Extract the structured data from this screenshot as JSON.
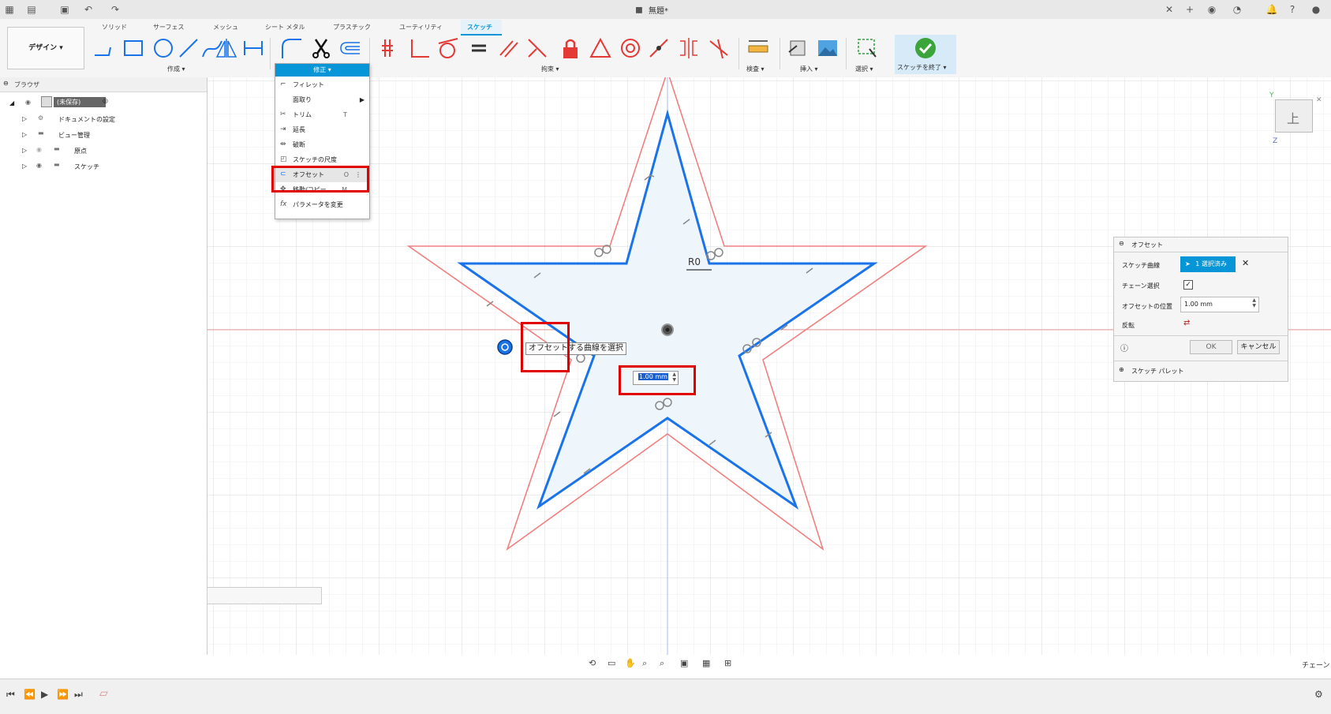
{
  "title": "無題*",
  "tabs": [
    "ソリッド",
    "サーフェス",
    "メッシュ",
    "シート メタル",
    "プラスチック",
    "ユーティリティ",
    "スケッチ"
  ],
  "active_tab": "スケッチ",
  "design_button": "デザイン ▾",
  "groups": {
    "create": "作成 ▾",
    "constraints": "拘束 ▾",
    "inspect": "検査 ▾",
    "insert": "挿入 ▾",
    "select": "選択 ▾",
    "finish": "スケッチを終了 ▾"
  },
  "browser": {
    "title": "ブラウザ",
    "root": "(未保存)",
    "items": [
      "ドキュメントの設定",
      "ビュー管理",
      "原点",
      "スケッチ"
    ]
  },
  "modify_menu": {
    "header": "修正 ▾",
    "items": [
      {
        "label": "フィレット",
        "shortcut": ""
      },
      {
        "label": "面取り",
        "shortcut": "▶"
      },
      {
        "label": "トリム",
        "shortcut": "T"
      },
      {
        "label": "延長",
        "shortcut": ""
      },
      {
        "label": "破断",
        "shortcut": ""
      },
      {
        "label": "スケッチの尺度",
        "shortcut": ""
      },
      {
        "label": "オフセット",
        "shortcut": "O"
      },
      {
        "label": "移動/コピー",
        "shortcut": "M"
      },
      {
        "label": "パラメータを変更",
        "shortcut": ""
      }
    ]
  },
  "viewcube": {
    "face": "上",
    "axis_y": "Y",
    "axis_z": "Z"
  },
  "canvas": {
    "tooltip": "オフセットする曲線を選択",
    "offset_input": "1.00 mm",
    "dimension": "R0"
  },
  "offset_dialog": {
    "title": "オフセット",
    "sketch_curve_label": "スケッチ曲線",
    "sketch_curve_value": "1 選択済み",
    "chain_label": "チェーン選択",
    "chain_checked": true,
    "position_label": "オフセットの位置",
    "position_value": "1.00 mm",
    "flip_label": "反転",
    "ok": "OK",
    "cancel": "キャンセル",
    "palette": "スケッチ パレット"
  },
  "status_right": "チェーン",
  "colors": {
    "accent": "#0696d7",
    "star_blue": "#1a73e8",
    "offset_red": "#f08080",
    "highlight_red": "#e00000"
  }
}
